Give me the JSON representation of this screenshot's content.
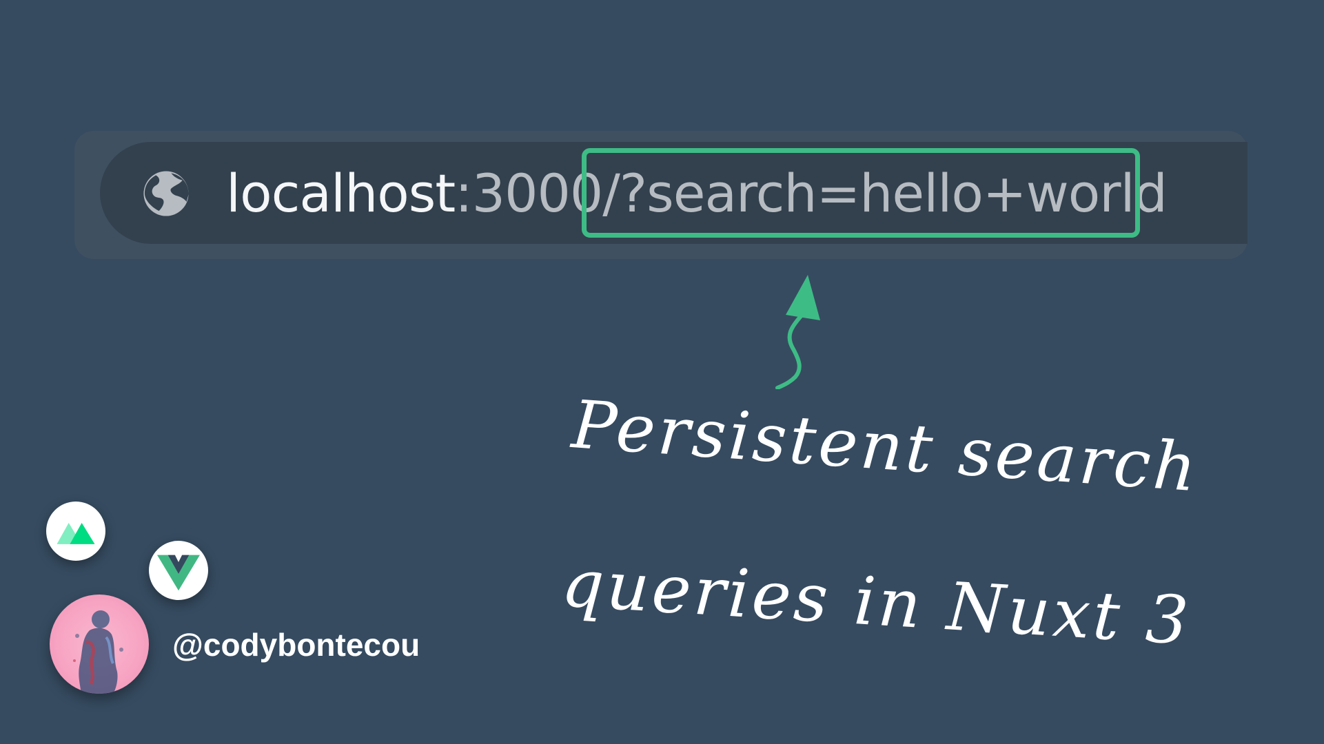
{
  "address_bar": {
    "host": "localhost",
    "port": ":3000",
    "query": "/?search=hello+world"
  },
  "caption": {
    "line1": "Persistent search",
    "line2": "queries in Nuxt 3"
  },
  "author": {
    "handle": "@codybontecou"
  },
  "icons": {
    "globe": "globe-icon",
    "arrow": "arrow-up-icon",
    "nuxt": "nuxt-logo-icon",
    "vue": "vue-logo-icon"
  },
  "colors": {
    "background": "#364b60",
    "accent_green": "#3ebc86",
    "nuxt_green": "#00dc82",
    "vue_green": "#41b883",
    "vue_dark": "#34495e"
  }
}
